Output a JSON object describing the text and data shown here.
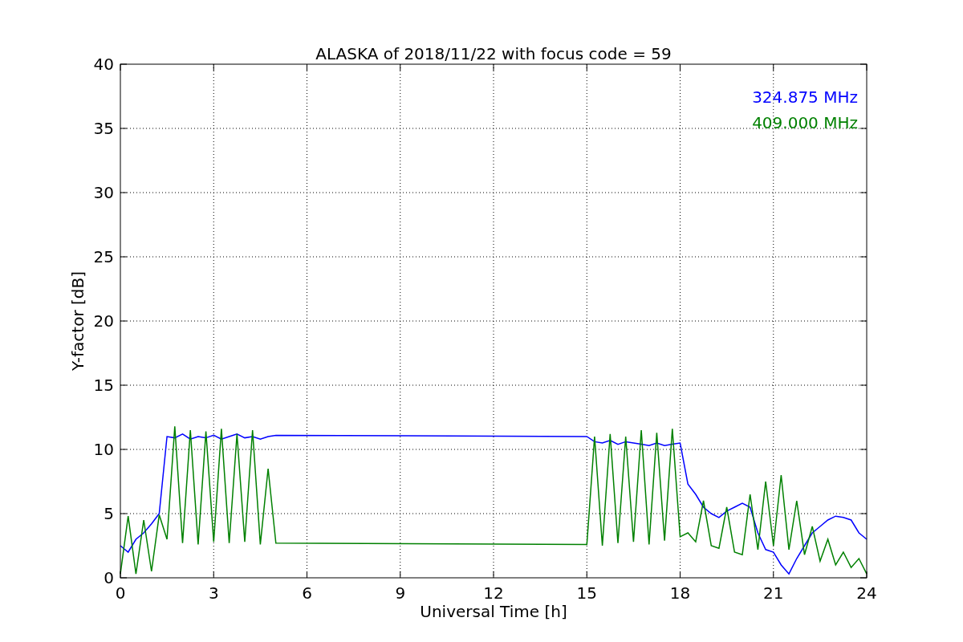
{
  "chart_data": {
    "type": "line",
    "title": "ALASKA of 2018/11/22 with focus code = 59",
    "xlabel": "Universal Time [h]",
    "ylabel": "Y-factor [dB]",
    "x": [
      0,
      0.25,
      0.5,
      0.75,
      1,
      1.25,
      1.5,
      1.75,
      2,
      2.25,
      2.5,
      2.75,
      3,
      3.25,
      3.5,
      3.75,
      4,
      4.25,
      4.5,
      4.75,
      5,
      15,
      15.25,
      15.5,
      15.75,
      16,
      16.25,
      16.5,
      16.75,
      17,
      17.25,
      17.5,
      17.75,
      18,
      18.25,
      18.5,
      18.75,
      19,
      19.25,
      19.5,
      19.75,
      20,
      20.25,
      20.5,
      20.75,
      21,
      21.25,
      21.5,
      21.75,
      22,
      22.25,
      22.5,
      22.75,
      23,
      23.25,
      23.5,
      23.75,
      24
    ],
    "series": [
      {
        "name": "324.875 MHz",
        "color": "#0000ff",
        "values": [
          2.5,
          2,
          3,
          3.5,
          4.2,
          5,
          11,
          10.9,
          11.2,
          10.8,
          11,
          10.9,
          11.1,
          10.8,
          11,
          11.2,
          10.9,
          11,
          10.8,
          11,
          11.1,
          11,
          10.6,
          10.5,
          10.7,
          10.4,
          10.6,
          10.5,
          10.4,
          10.3,
          10.5,
          10.3,
          10.4,
          10.5,
          7.3,
          6.5,
          5.5,
          5,
          4.7,
          5.2,
          5.5,
          5.8,
          5.5,
          3.5,
          2.2,
          2,
          1,
          0.3,
          1.5,
          2.5,
          3.5,
          4,
          4.5,
          4.8,
          4.7,
          4.5,
          3.5,
          3
        ]
      },
      {
        "name": "409.000 MHz",
        "color": "#008000",
        "values": [
          0.3,
          4.8,
          0.3,
          4.5,
          0.5,
          4.9,
          3,
          11.8,
          2.7,
          11.5,
          2.6,
          11.4,
          2.8,
          11.6,
          2.7,
          11.2,
          2.8,
          11.5,
          2.6,
          8.5,
          2.7,
          2.6,
          11,
          2.5,
          11.2,
          2.7,
          11,
          2.8,
          11.5,
          2.6,
          11.3,
          2.9,
          11.6,
          3.2,
          3.5,
          2.8,
          6,
          2.5,
          2.3,
          5.5,
          2,
          1.8,
          6.5,
          2.2,
          7.5,
          2.5,
          8,
          2.2,
          6,
          1.8,
          4,
          1.3,
          3,
          1,
          2,
          0.8,
          1.5,
          0.3
        ]
      }
    ],
    "xlim": [
      0,
      24
    ],
    "ylim": [
      0,
      40
    ],
    "xticks": [
      0,
      3,
      6,
      9,
      12,
      15,
      18,
      21,
      24
    ],
    "yticks": [
      0,
      5,
      10,
      15,
      20,
      25,
      30,
      35,
      40
    ],
    "grid": true
  }
}
